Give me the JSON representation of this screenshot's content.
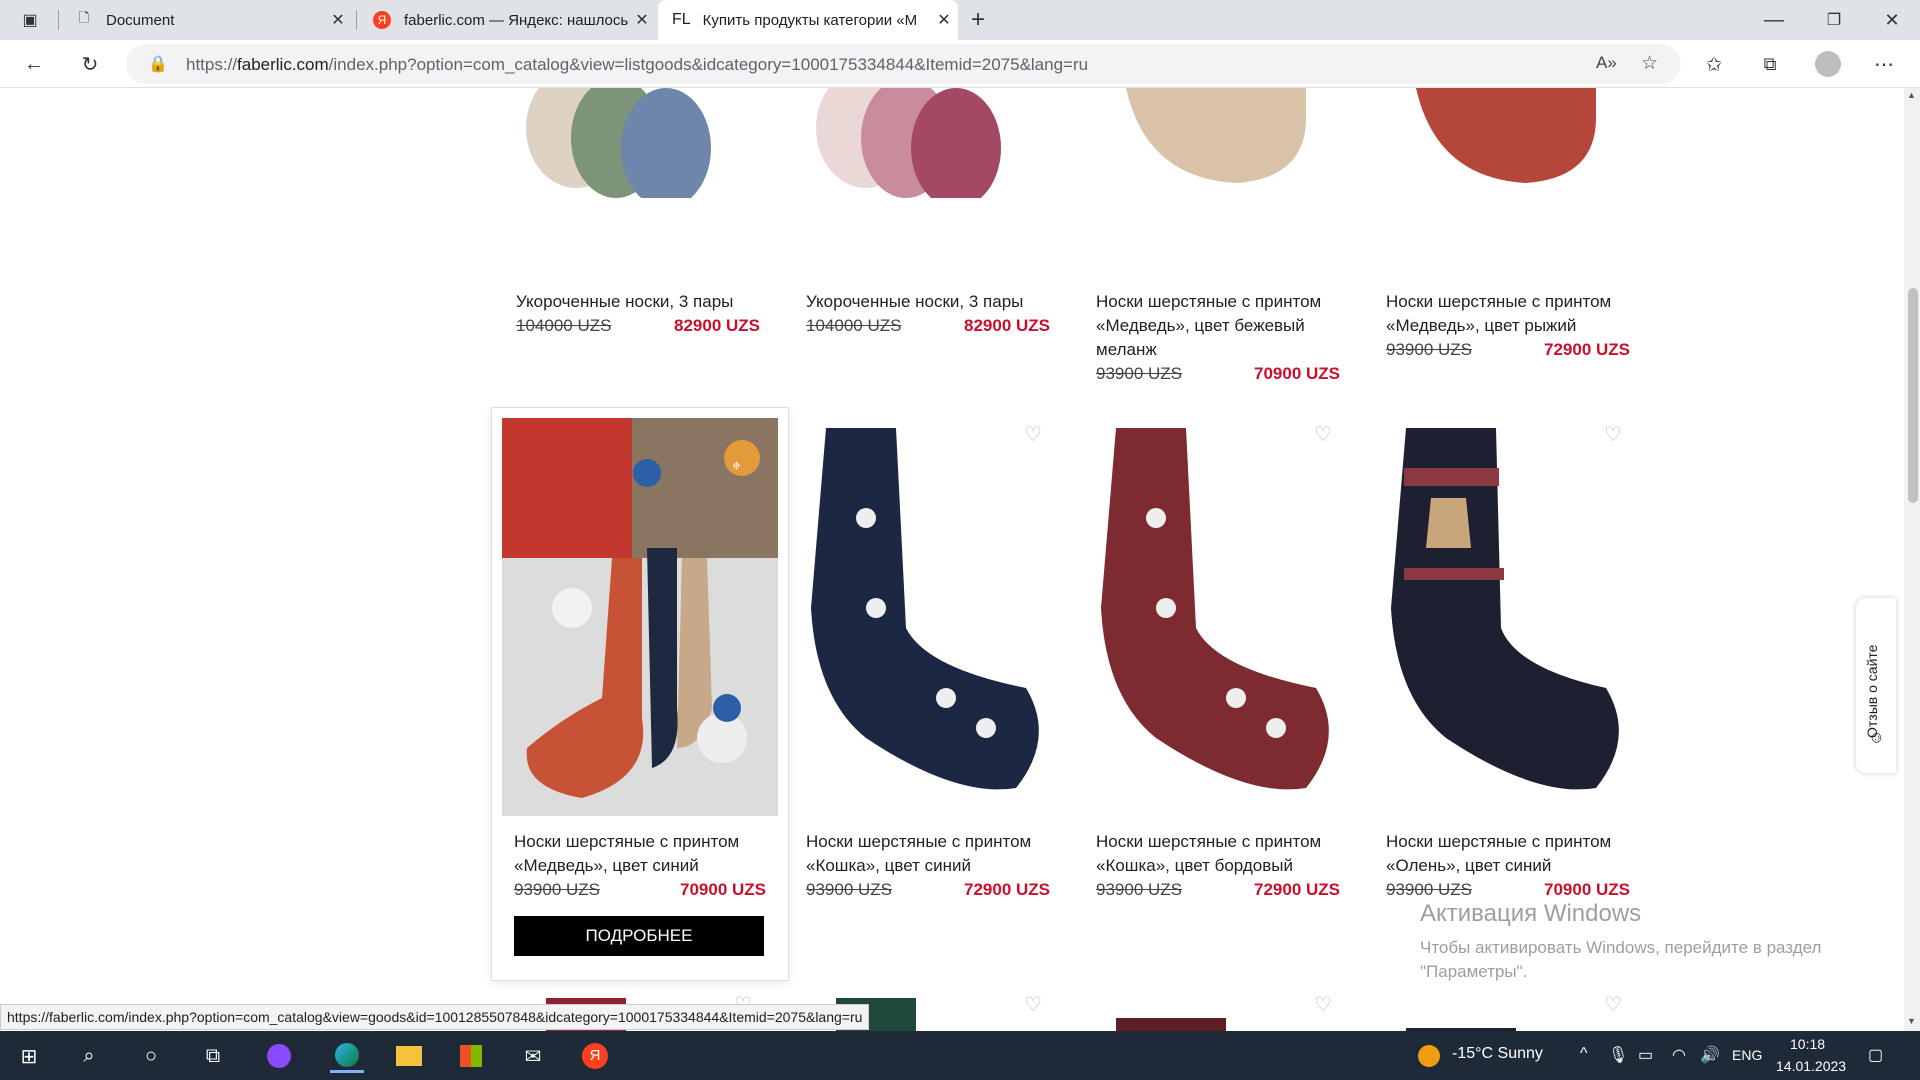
{
  "tabs": [
    {
      "title": "Document",
      "active": false
    },
    {
      "title": "faberlic.com — Яндекс: нашлось",
      "active": false
    },
    {
      "title": "Купить продукты категории «М",
      "active": true
    }
  ],
  "tab_favicon_fl": "FL",
  "address": {
    "prefix": "https://",
    "domain": "faberlic.com",
    "path": "/index.php?option=com_catalog&view=listgoods&idcategory=1000175334844&Itemid=2075&lang=ru"
  },
  "products_row1": [
    {
      "name": "Укороченные носки, 3 пары",
      "old": "104000 UZS",
      "new": "82900 UZS"
    },
    {
      "name": "Укороченные носки, 3 пары",
      "old": "104000 UZS",
      "new": "82900 UZS"
    },
    {
      "name": "Носки шерстяные с принтом «Медведь», цвет бежевый меланж",
      "old": "93900 UZS",
      "new": "70900 UZS"
    },
    {
      "name": "Носки шерстяные с принтом «Медведь», цвет рыжий",
      "old": "93900 UZS",
      "new": "72900 UZS"
    }
  ],
  "products_row2": [
    {
      "name": "Носки шерстяные с принтом «Медведь», цвет синий",
      "old": "93900 UZS",
      "new": "70900 UZS"
    },
    {
      "name": "Носки шерстяные с принтом «Кошка», цвет синий",
      "old": "93900 UZS",
      "new": "72900 UZS"
    },
    {
      "name": "Носки шерстяные с принтом «Кошка», цвет бордовый",
      "old": "93900 UZS",
      "new": "72900 UZS"
    },
    {
      "name": "Носки шерстяные с принтом «Олень», цвет синий",
      "old": "93900 UZS",
      "new": "70900 UZS"
    }
  ],
  "more_button": "ПОДРОБНЕЕ",
  "feedback_label": "Отзыв о сайте",
  "watermark": {
    "title": "Активация Windows",
    "text": "Чтобы активировать Windows, перейдите в раздел \"Параметры\"."
  },
  "status_url": "https://faberlic.com/index.php?option=com_catalog&view=goods&id=1001285507848&idcategory=1000175334844&Itemid=2075&lang=ru",
  "taskbar": {
    "weather": "-15°C  Sunny",
    "lang": "ENG",
    "time": "10:18",
    "date": "14.01.2023"
  },
  "colors": {
    "price": "#c8102e",
    "taskbar": "#1f2a38"
  }
}
